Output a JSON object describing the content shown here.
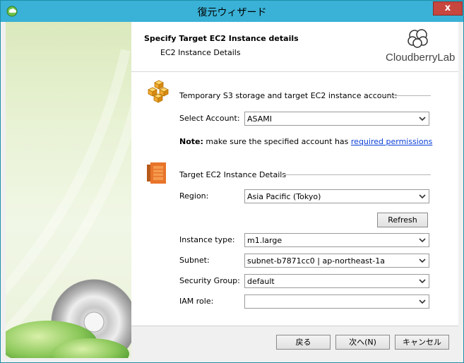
{
  "window": {
    "title": "復元ウィザード",
    "close_glyph": "x"
  },
  "header": {
    "title": "Specify Target EC2 Instance details",
    "subtitle": "EC2 Instance Details",
    "brand": "CloudberryLab"
  },
  "s3_section": {
    "heading": "Temporary S3 storage and target EC2 instance account:",
    "account_label": "Select Account:",
    "account_value": "ASAMI",
    "note_bold": "Note:",
    "note_text": " make sure the specified account has ",
    "note_link": "required permissions"
  },
  "ec2_section": {
    "heading": "Target EC2 Instance Details",
    "region_label": "Region:",
    "region_value": "Asia Pacific (Tokyo)",
    "refresh_label": "Refresh",
    "instance_type_label": "Instance type:",
    "instance_type_value": "m1.large",
    "subnet_label": "Subnet:",
    "subnet_value": "subnet-b7871cc0 | ap-northeast-1a",
    "security_group_label": "Security Group:",
    "security_group_value": "default",
    "iam_role_label": "IAM role:",
    "iam_role_value": ""
  },
  "footer": {
    "back_label": "戻る",
    "next_label": "次へ(N)",
    "cancel_label": "キャンセル"
  },
  "colors": {
    "titlebar": "#3ab1d6",
    "close": "#c7463e",
    "link": "#0b3fd6",
    "s3_icon": "#f0a830",
    "ec2_icon": "#e8742a"
  }
}
